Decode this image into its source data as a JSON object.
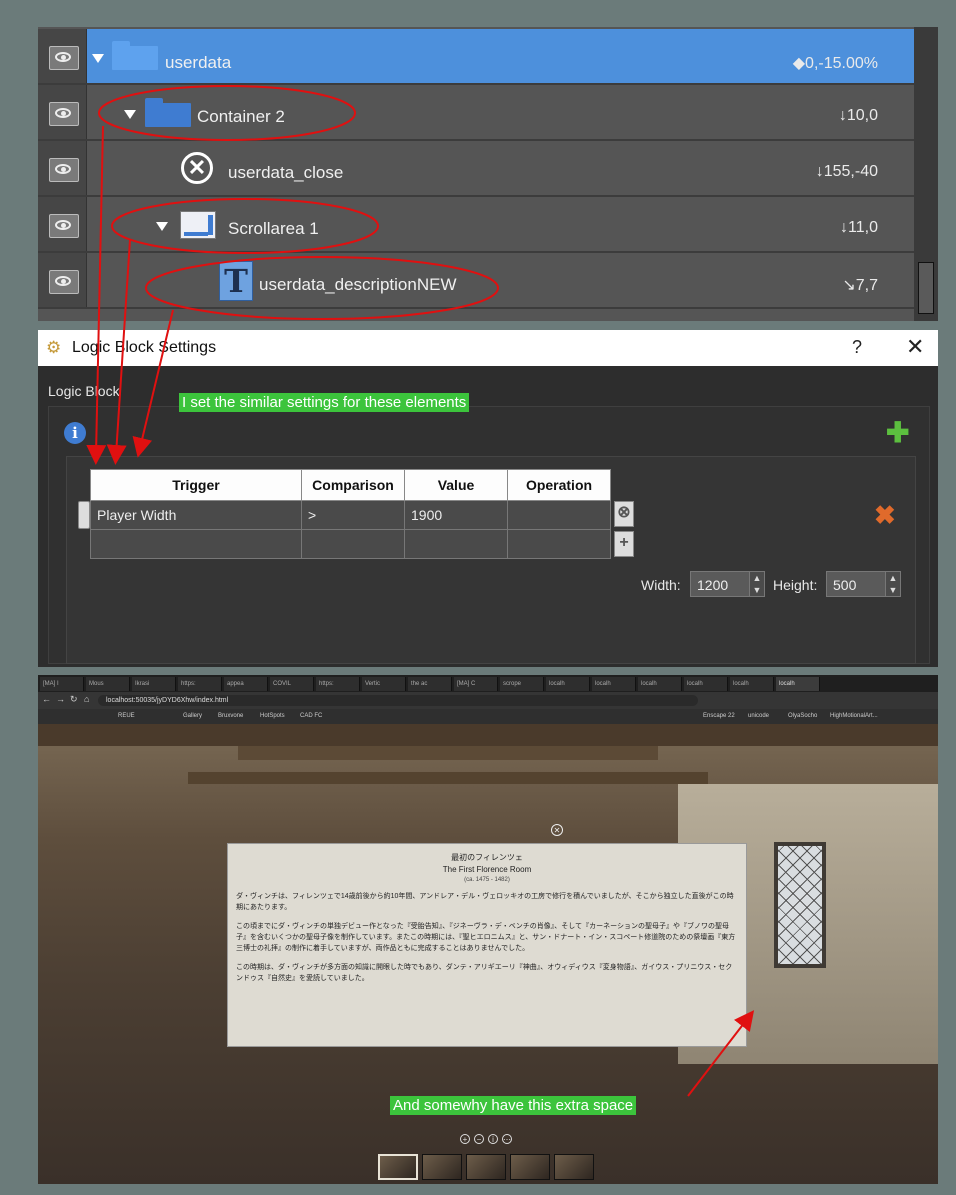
{
  "tree": {
    "rows": [
      {
        "label": "userdata",
        "value": "◆0,-15.00%"
      },
      {
        "label": "Container 2",
        "value": "↓10,0"
      },
      {
        "label": "userdata_close",
        "value": "↓155,-40"
      },
      {
        "label": "Scrollarea 1",
        "value": "↓11,0"
      },
      {
        "label": "userdata_descriptionNEW",
        "value": "↘7,7"
      }
    ]
  },
  "dialog": {
    "title": "Logic Block Settings",
    "help": "?",
    "close": "✕",
    "group_label": "Logic Block",
    "table": {
      "headers": [
        "Trigger",
        "Comparison",
        "Value",
        "Operation"
      ],
      "rows": [
        [
          "Player Width",
          ">",
          "1900",
          ""
        ],
        [
          "",
          "",
          "",
          ""
        ]
      ]
    },
    "width_label": "Width:",
    "width_value": "1200",
    "height_label": "Height:",
    "height_value": "500"
  },
  "browser": {
    "tabs": [
      "[MA] I",
      "Mous",
      "Ikrasi",
      "https:",
      "appea",
      "COVIL",
      "https:",
      "Vertic",
      "the ac",
      "[MA] C",
      "scrope",
      "localh",
      "localh",
      "localh",
      "localh",
      "localh",
      "localh"
    ],
    "address": "localhost:50035/jyDYD6Xhw/index.html",
    "bookmarks": [
      "REUE",
      "Gallery",
      "Bruxvone",
      "HotSpots",
      "CAD FC",
      "Enscape 22",
      "unicode",
      "OlyaSocho",
      "HighMotionalArt..."
    ],
    "popup": {
      "title_ja": "最初のフィレンツェ",
      "title_en": "The First Florence Room",
      "dates": "(ca. 1475 - 1482)",
      "paragraphs": [
        "ダ・ヴィンチは、フィレンツェで14歳前後から約10年間、アンドレア・デル・ヴェロッキオの工房で修行を積んでいましたが、そこから独立した直後がこの時期にあたります。",
        "この頃までにダ・ヴィンチの単独デビュー作となった『受胎告知』、『ジネーヴラ・デ・ベンチの肖像』、そして『カーネーションの聖母子』や『ブノワの聖母子』を含むいくつかの聖母子像を制作しています。またこの時期には、『聖ヒエロニムス』と、サン・ドナート・イン・スコペート修道院のための祭壇画『東方三博士の礼拝』の制作に着手していますが、両作品ともに完成することはありませんでした。",
        "この時期は、ダ・ヴィンチが多方面の知識に開眼した時でもあり、ダンテ・アリギエーリ『神曲』、オウィディウス『変身物語』、ガイウス・プリニウス・セクンドゥス『自然史』を愛読していました。"
      ]
    }
  },
  "notes": {
    "top": "I set the similar settings for these elements",
    "bottom": "And somewhy have this extra space"
  },
  "colors": {
    "selection": "#4d90dc",
    "annotation_red": "#e01010",
    "note_green": "#3cc43c"
  }
}
